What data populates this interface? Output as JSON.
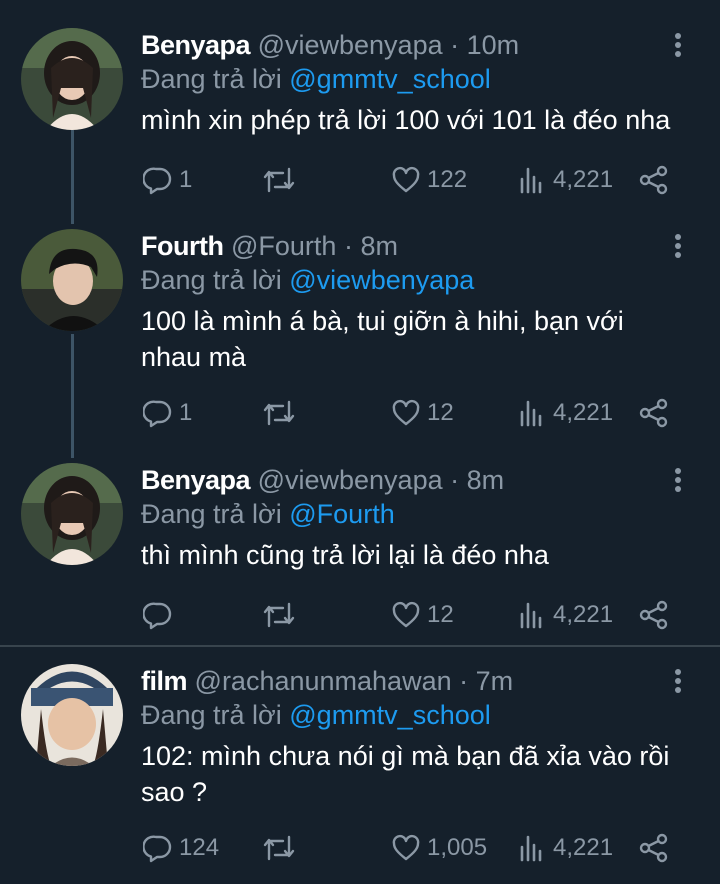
{
  "theme": {
    "background": "#15202b",
    "text": "#ffffff",
    "muted": "#8b98a5",
    "link": "#1d9bf0",
    "thread_line": "#3d5466"
  },
  "tweets": [
    {
      "name": "Benyapa",
      "handle": "@viewbenyapa",
      "dot": "·",
      "time": "10m",
      "replying_prefix": "Đang trả lời ",
      "replying_to": "@gmmtv_school",
      "text": "mình xin phép trả lời 100 với 101 là đéo nha",
      "replies": "1",
      "retweets": "",
      "likes": "122",
      "views": "4,221"
    },
    {
      "name": "Fourth",
      "handle": "@Fourth",
      "dot": "·",
      "time": "8m",
      "replying_prefix": "Đang trả lời ",
      "replying_to": "@viewbenyapa",
      "text": "100 là mình á bà, tui giỡn à hihi, bạn với nhau mà",
      "replies": "1",
      "retweets": "",
      "likes": "12",
      "views": "4,221"
    },
    {
      "name": "Benyapa",
      "handle": "@viewbenyapa",
      "dot": "·",
      "time": "8m",
      "replying_prefix": "Đang trả lời ",
      "replying_to": "@Fourth",
      "text": "thì mình cũng trả lời lại là đéo nha",
      "replies": "",
      "retweets": "",
      "likes": "12",
      "views": "4,221"
    },
    {
      "name": "film",
      "handle": "@rachanunmahawan",
      "dot": "·",
      "time": "7m",
      "replying_prefix": "Đang trả lời ",
      "replying_to": "@gmmtv_school",
      "text": "102: mình chưa nói gì mà bạn đã xỉa vào rồi sao ?",
      "replies": "124",
      "retweets": "",
      "likes": "1,005",
      "views": "4,221"
    }
  ]
}
